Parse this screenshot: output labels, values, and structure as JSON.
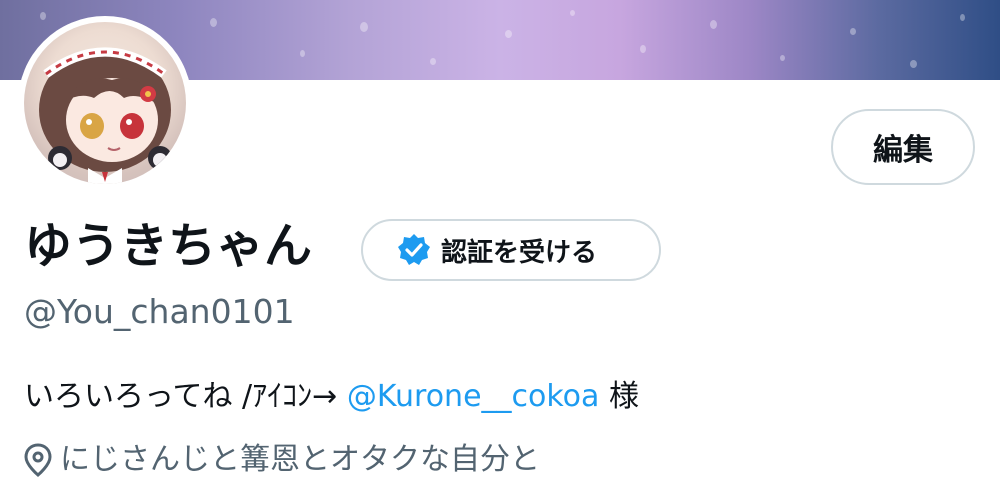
{
  "profile": {
    "display_name": "ゆうきちゃん",
    "handle": "@You_chan0101",
    "bio": {
      "text": "いろいろってね /ｱｲｺﾝ→ ",
      "mention": "@Kurone__cokoa",
      "suffix": " 様"
    },
    "location": "にじさんじと篝恩とオタクな自分と"
  },
  "buttons": {
    "edit_label": "編集",
    "verify_label": "認証を受ける"
  },
  "icons": {
    "verified": "verified-badge-icon",
    "location": "location-pin-icon"
  },
  "colors": {
    "accent": "#1d9bf0",
    "secondary_text": "#536471",
    "border": "#cfd9de"
  }
}
